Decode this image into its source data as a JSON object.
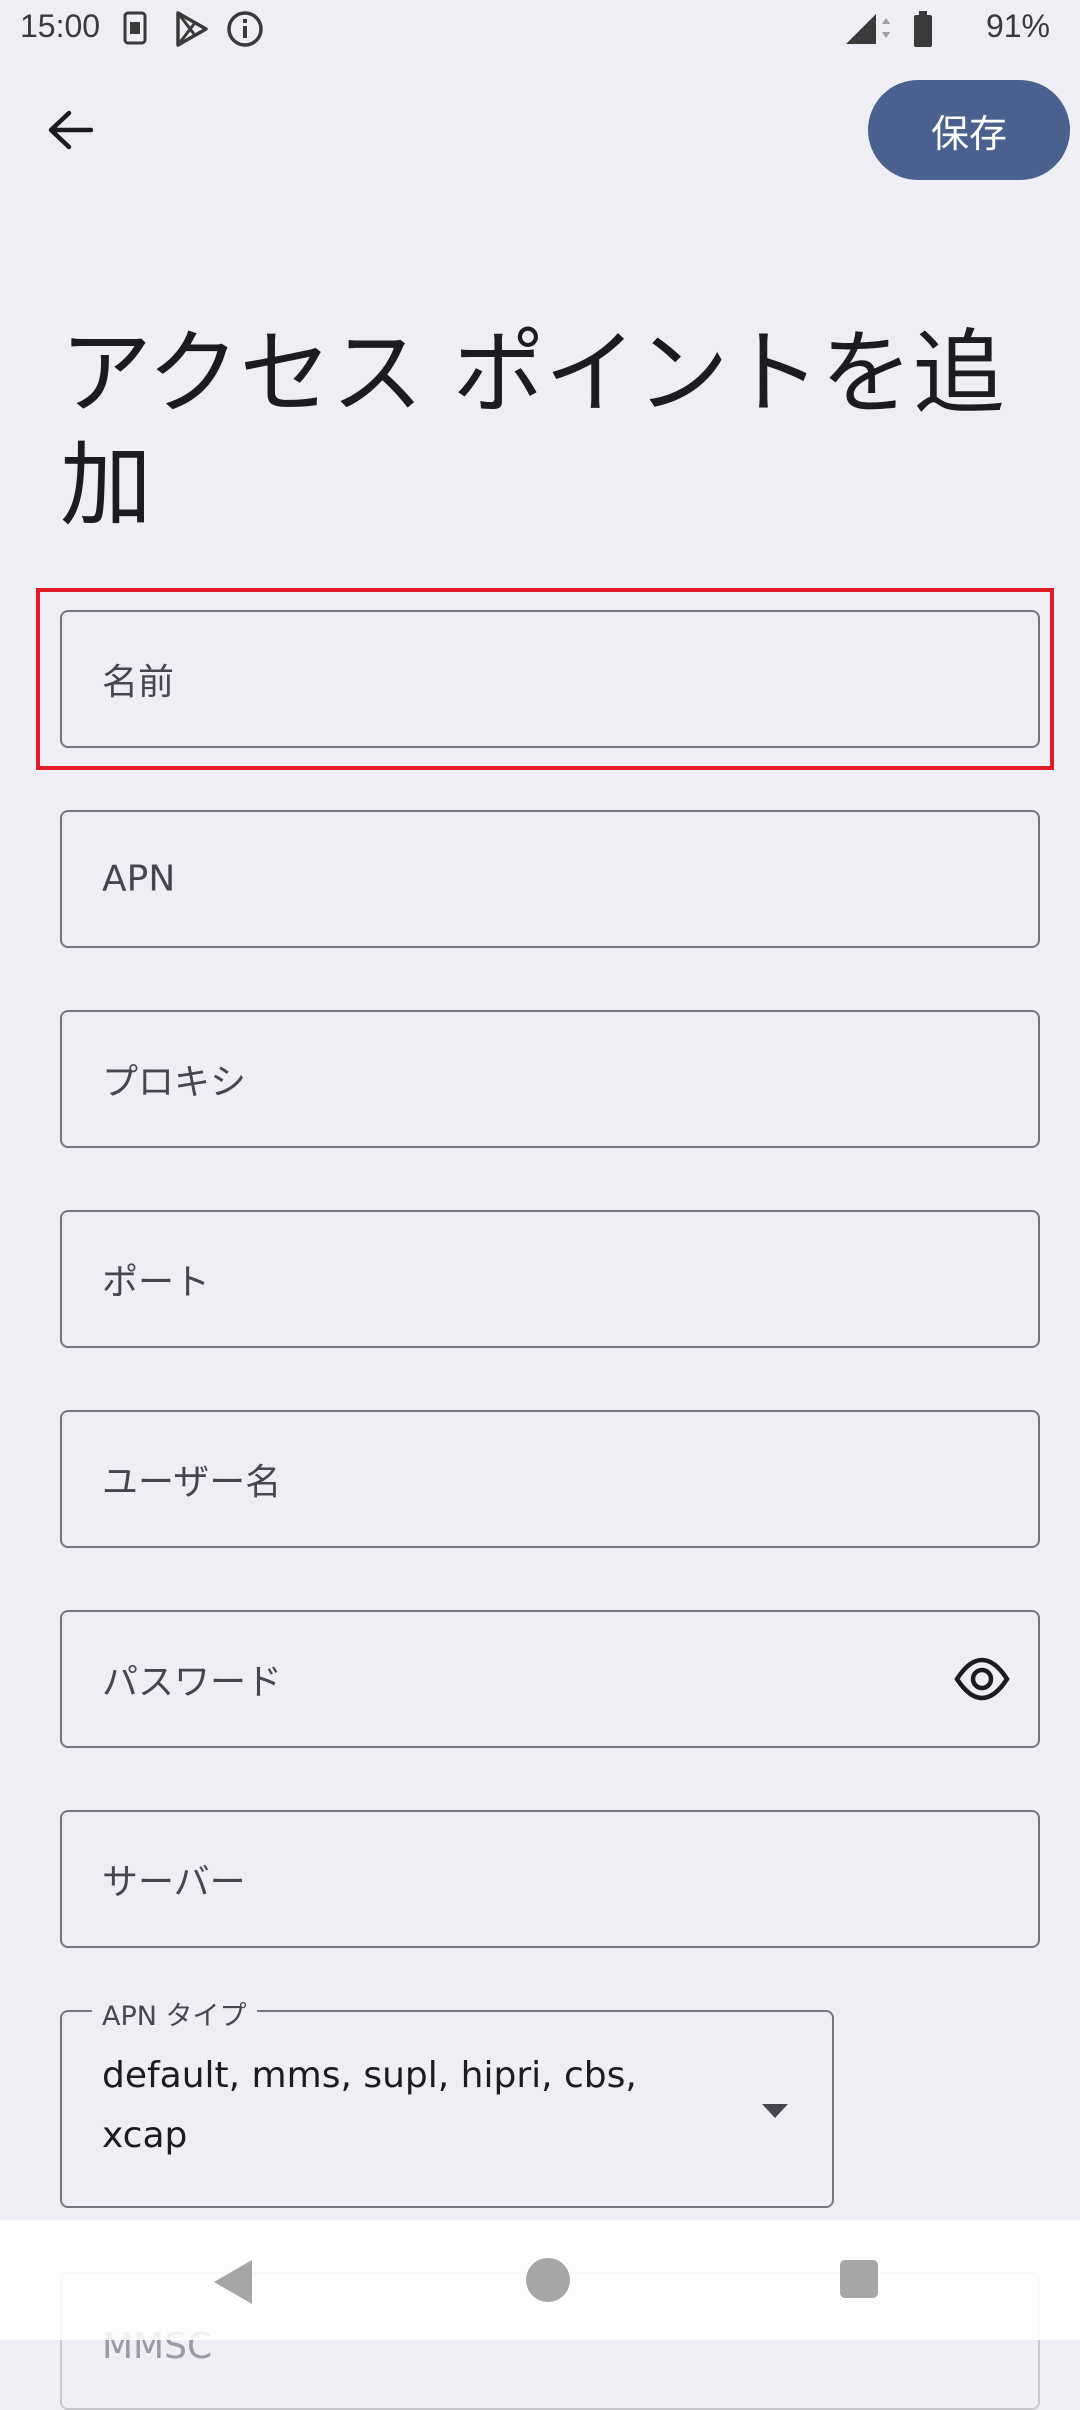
{
  "status_bar": {
    "time": "15:00",
    "battery_text": "91%",
    "icons": [
      "sim-card-icon",
      "play-store-icon",
      "info-icon",
      "signal-icon",
      "battery-icon"
    ]
  },
  "top_bar": {
    "save_label": "保存",
    "back_icon": "arrow-left-icon"
  },
  "title": "アクセス ポイントを追加",
  "fields": {
    "name": "名前",
    "apn": "APN",
    "proxy": "プロキシ",
    "port": "ポート",
    "username": "ユーザー名",
    "password": "パスワード",
    "server": "サーバー"
  },
  "apn_type": {
    "label": "APN タイプ",
    "value": "default, mms, supl, hipri, cbs, xcap"
  },
  "mmsc": {
    "label": "MMSC"
  },
  "colors": {
    "accent": "#4a6190",
    "background": "#efeef4",
    "highlight": "#e01b24",
    "outline": "#79747e"
  }
}
